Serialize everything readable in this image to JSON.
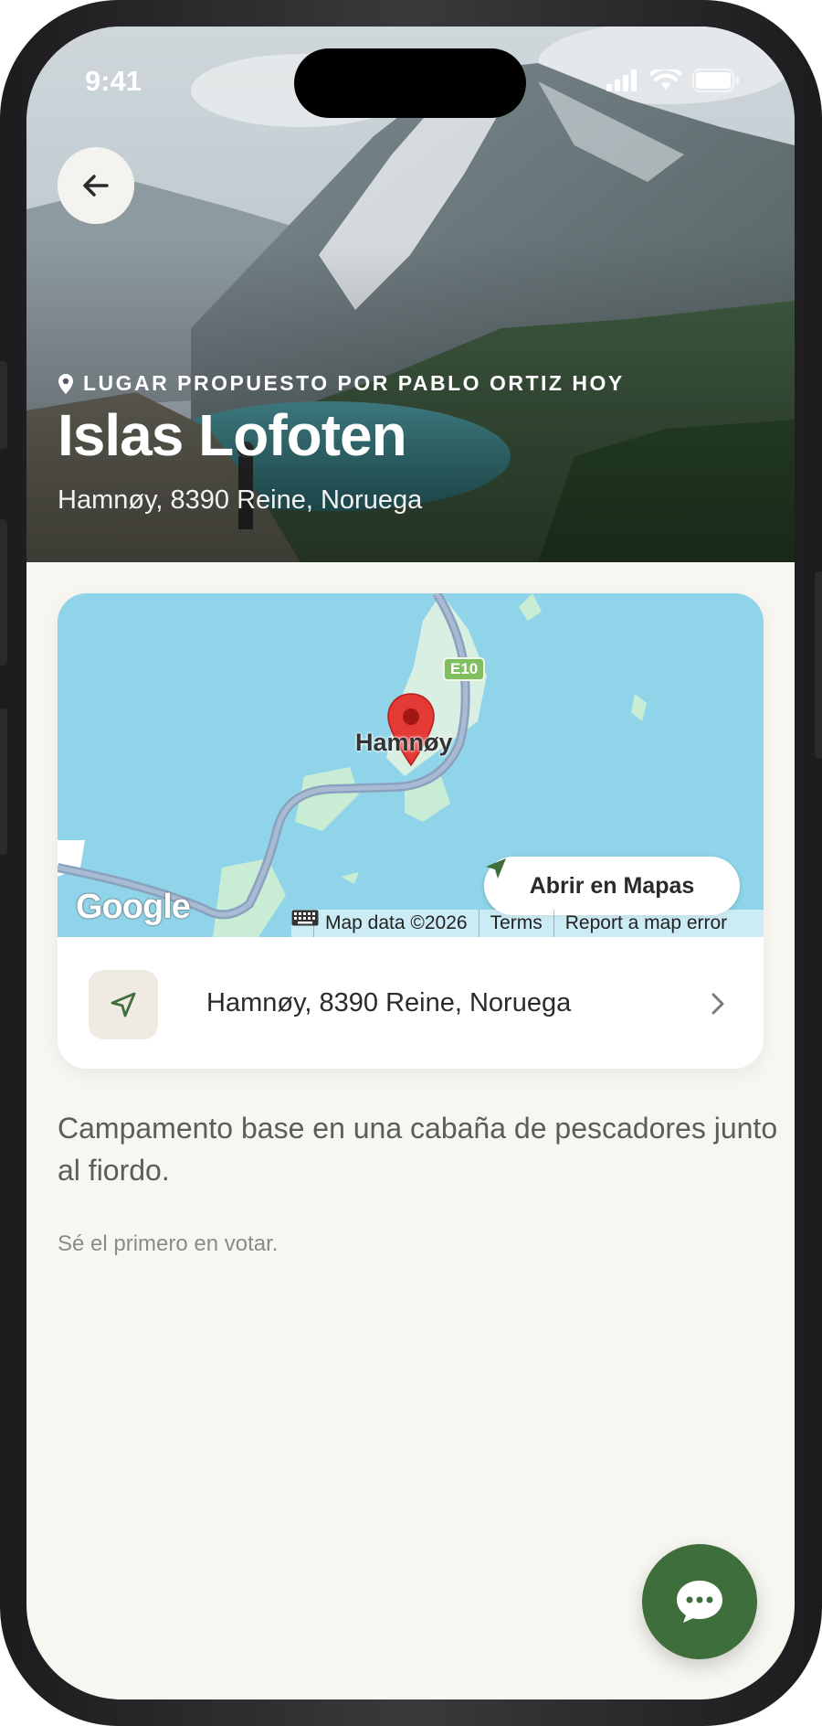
{
  "status_bar": {
    "time": "9:41"
  },
  "hero": {
    "proposer": "LUGAR PROPUESTO POR PABLO ORTIZ HOY",
    "title": "Islas Lofoten",
    "address": "Hamnøy, 8390 Reine, Noruega"
  },
  "map": {
    "place_label": "Hamnøy",
    "route_badge": "E10",
    "open_button": "Abrir en Mapas",
    "provider": "Google",
    "attribution": [
      "Map data ©2026",
      "Terms",
      "Report a map error"
    ]
  },
  "location_row": {
    "address": "Hamnøy, 8390 Reine, Noruega"
  },
  "description": "Campamento base en una cabaña de pescadores junto al fiordo.",
  "vote_prompt": "Sé el primero en votar.",
  "colors": {
    "accent": "#3e6e3c",
    "background": "#f8f6f1",
    "map_water": "#8fd4e9",
    "pin": "#e53935"
  },
  "icons": [
    "back-arrow-icon",
    "location-pin-icon",
    "navigation-arrow-icon",
    "keyboard-icon",
    "chevron-right-icon",
    "chat-bubble-icon",
    "signal-icon",
    "wifi-icon",
    "battery-icon"
  ]
}
